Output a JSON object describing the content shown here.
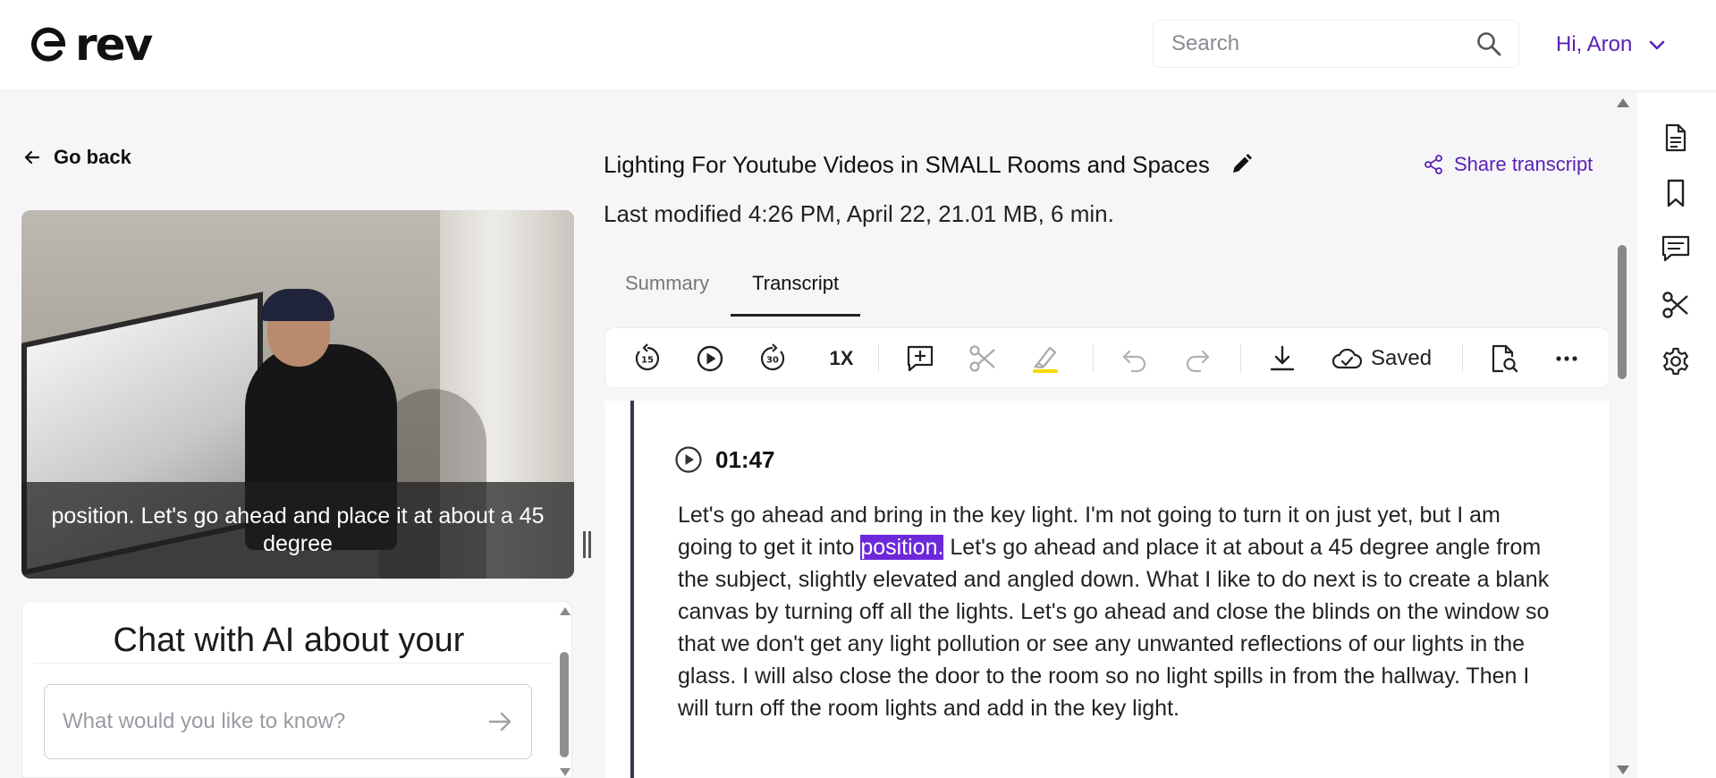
{
  "header": {
    "logo_text": "rev",
    "search_placeholder": "Search",
    "user_greeting": "Hi, Aron"
  },
  "left": {
    "go_back": "Go back",
    "video_caption": "position. Let's go ahead and place it at about a 45 degree",
    "chat_title": "Chat with AI about your",
    "chat_placeholder": "What would you like to know?"
  },
  "main": {
    "title": "Lighting For Youtube Videos in SMALL Rooms and Spaces",
    "share_label": "Share transcript",
    "meta": "Last modified 4:26 PM, April 22, 21.01 MB, 6 min.",
    "tabs": [
      {
        "label": "Summary",
        "active": false
      },
      {
        "label": "Transcript",
        "active": true
      }
    ],
    "toolbar": {
      "speed": "1X",
      "saved": "Saved"
    },
    "transcript": {
      "timestamp": "01:47",
      "text_before": "Let's go ahead and bring in the key light. I'm not going to turn it on just yet, but I am going to get it into ",
      "highlight": "position.",
      "text_after": " Let's go ahead and place it at about a 45 degree angle from the subject, slightly elevated and angled down. What I like to do next is to create a blank canvas by turning off all the lights. Let's go ahead and close the blinds on the window so that we don't get any light pollution or see any unwanted reflections of our lights in the glass. I will also close the door to the room so no light spills in from the hallway. Then I will turn off the room lights and add in the key light."
    }
  },
  "colors": {
    "accent": "#5b21b6",
    "highlight": "#6d28d9",
    "marker_yellow": "#f5d90a"
  }
}
